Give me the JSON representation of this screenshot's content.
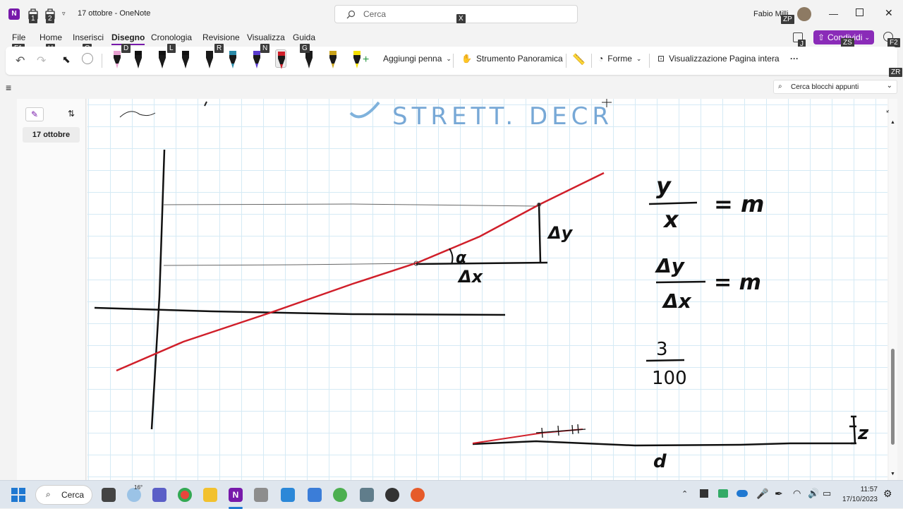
{
  "window": {
    "page_title": "17 ottobre",
    "separator": "-",
    "app_name": "OneNote",
    "user_name": "Fabio Milli",
    "search_placeholder": "Cerca"
  },
  "keytips": {
    "save1": "1",
    "save2": "2",
    "search": "X",
    "zp": "ZP",
    "j": "J",
    "zs": "ZS",
    "f2": "F2",
    "f1": "F1",
    "h": "H",
    "c": "C",
    "d": "D",
    "l": "L",
    "r": "R",
    "n": "N",
    "g": "G",
    "zr": "ZR"
  },
  "menu": {
    "file": "File",
    "home": "Home",
    "insert": "Inserisci",
    "draw": "Disegno",
    "history": "Cronologia",
    "review": "Revisione",
    "view": "Visualizza",
    "help": "Guida",
    "share": "Condividi"
  },
  "ribbon": {
    "add_pen": "Aggiungi penna",
    "pan_tool": "Strumento Panoramica",
    "shapes": "Forme",
    "full_page_view": "Visualizzazione Pagina intera",
    "more": "···",
    "pen_colors": [
      "#e8a0d0",
      "#111111",
      "#111111",
      "#111111",
      "#1a1a1a",
      "#2a8aa8",
      "#5a3bcf",
      "#d01f2a",
      "#1a1a1a",
      "#c9a21a",
      "#f5e000",
      "#111111"
    ]
  },
  "navigation": {
    "notebook_search": "Cerca blocchi appunti",
    "page_item": "17 ottobre"
  },
  "handwriting": {
    "header": "STRETT. DECR",
    "alpha": "α",
    "delta_x": "Δx",
    "delta_y": "Δy",
    "formula1_num": "y",
    "formula1_den": "x",
    "formula1_rhs": "= m",
    "formula2_num": "Δy",
    "formula2_den": "Δx",
    "formula2_rhs": "= m",
    "fraction_num": "3",
    "fraction_den": "100",
    "label_d": "d",
    "label_z": "z"
  },
  "taskbar": {
    "search": "Cerca",
    "temperature": "16°",
    "time": "11:57",
    "date": "17/10/2023"
  }
}
